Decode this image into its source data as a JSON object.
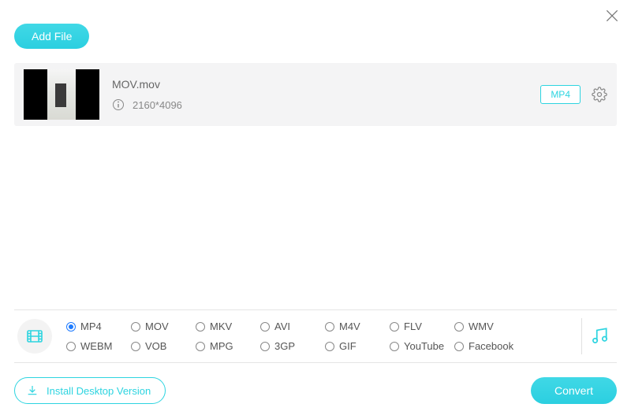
{
  "header": {
    "add_file_label": "Add File"
  },
  "file_row": {
    "name": "MOV.mov",
    "resolution": "2160*4096",
    "target_format_label": "MP4"
  },
  "formats": {
    "selected": "MP4",
    "items": [
      "MP4",
      "MOV",
      "MKV",
      "AVI",
      "M4V",
      "FLV",
      "WMV",
      "WEBM",
      "VOB",
      "MPG",
      "3GP",
      "GIF",
      "YouTube",
      "Facebook"
    ]
  },
  "footer": {
    "install_label": "Install Desktop Version",
    "convert_label": "Convert"
  }
}
